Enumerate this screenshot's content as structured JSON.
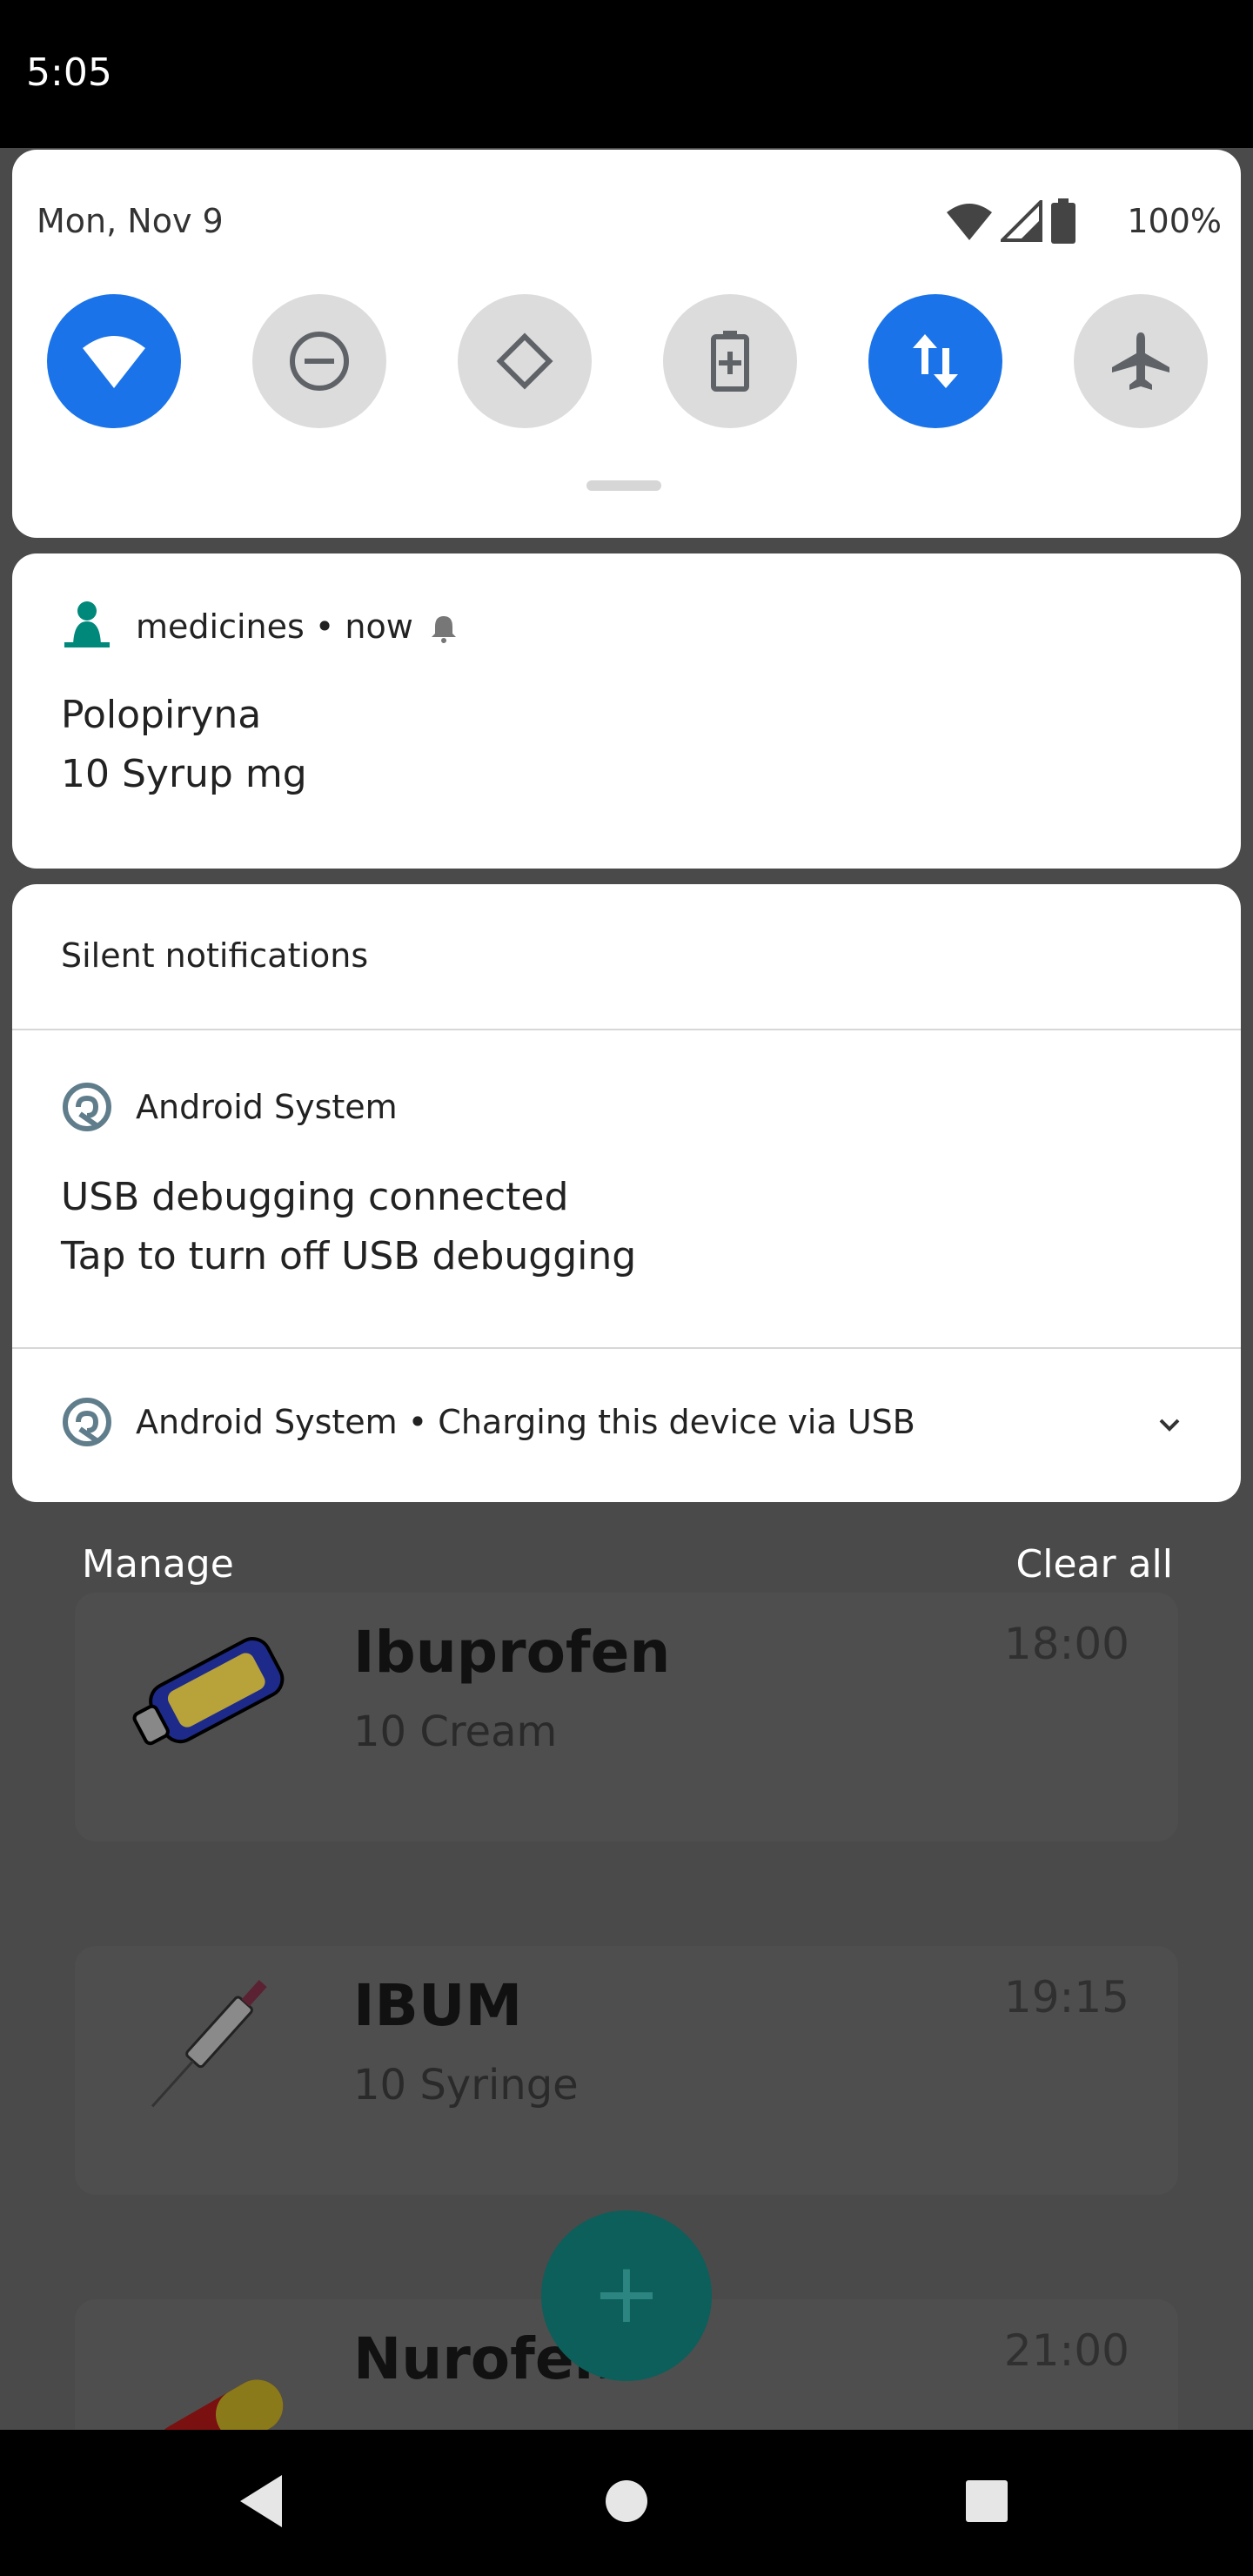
{
  "status_bar": {
    "time": "5:05"
  },
  "quick_settings": {
    "date": "Mon, Nov 9",
    "battery": "100%",
    "tiles": [
      {
        "name": "wifi",
        "state": "on"
      },
      {
        "name": "do-not-disturb",
        "state": "off"
      },
      {
        "name": "auto-rotate",
        "state": "off"
      },
      {
        "name": "battery-saver",
        "state": "off"
      },
      {
        "name": "mobile-data",
        "state": "on"
      },
      {
        "name": "airplane-mode",
        "state": "off"
      }
    ]
  },
  "notifications": {
    "medicines": {
      "app": "medicines",
      "time": "now",
      "title": "Polopiryna",
      "text": "10 Syrup mg"
    },
    "silent_header": "Silent notifications",
    "usb_debug": {
      "app": "Android System",
      "title": "USB debugging connected",
      "text": "Tap to turn off USB debugging"
    },
    "usb_charging": {
      "app": "Android System",
      "summary": "Charging this device via USB"
    }
  },
  "actions": {
    "manage": "Manage",
    "clear_all": "Clear all"
  },
  "background_list": [
    {
      "name": "Ibuprofen",
      "sub": "10 Cream",
      "time": "18:00"
    },
    {
      "name": "IBUM",
      "sub": "10 Syringe",
      "time": "19:15"
    },
    {
      "name": "Nurofen",
      "sub": "",
      "time": "21:00"
    }
  ],
  "colors": {
    "accent": "#1a73e8",
    "teal": "#00897b"
  }
}
